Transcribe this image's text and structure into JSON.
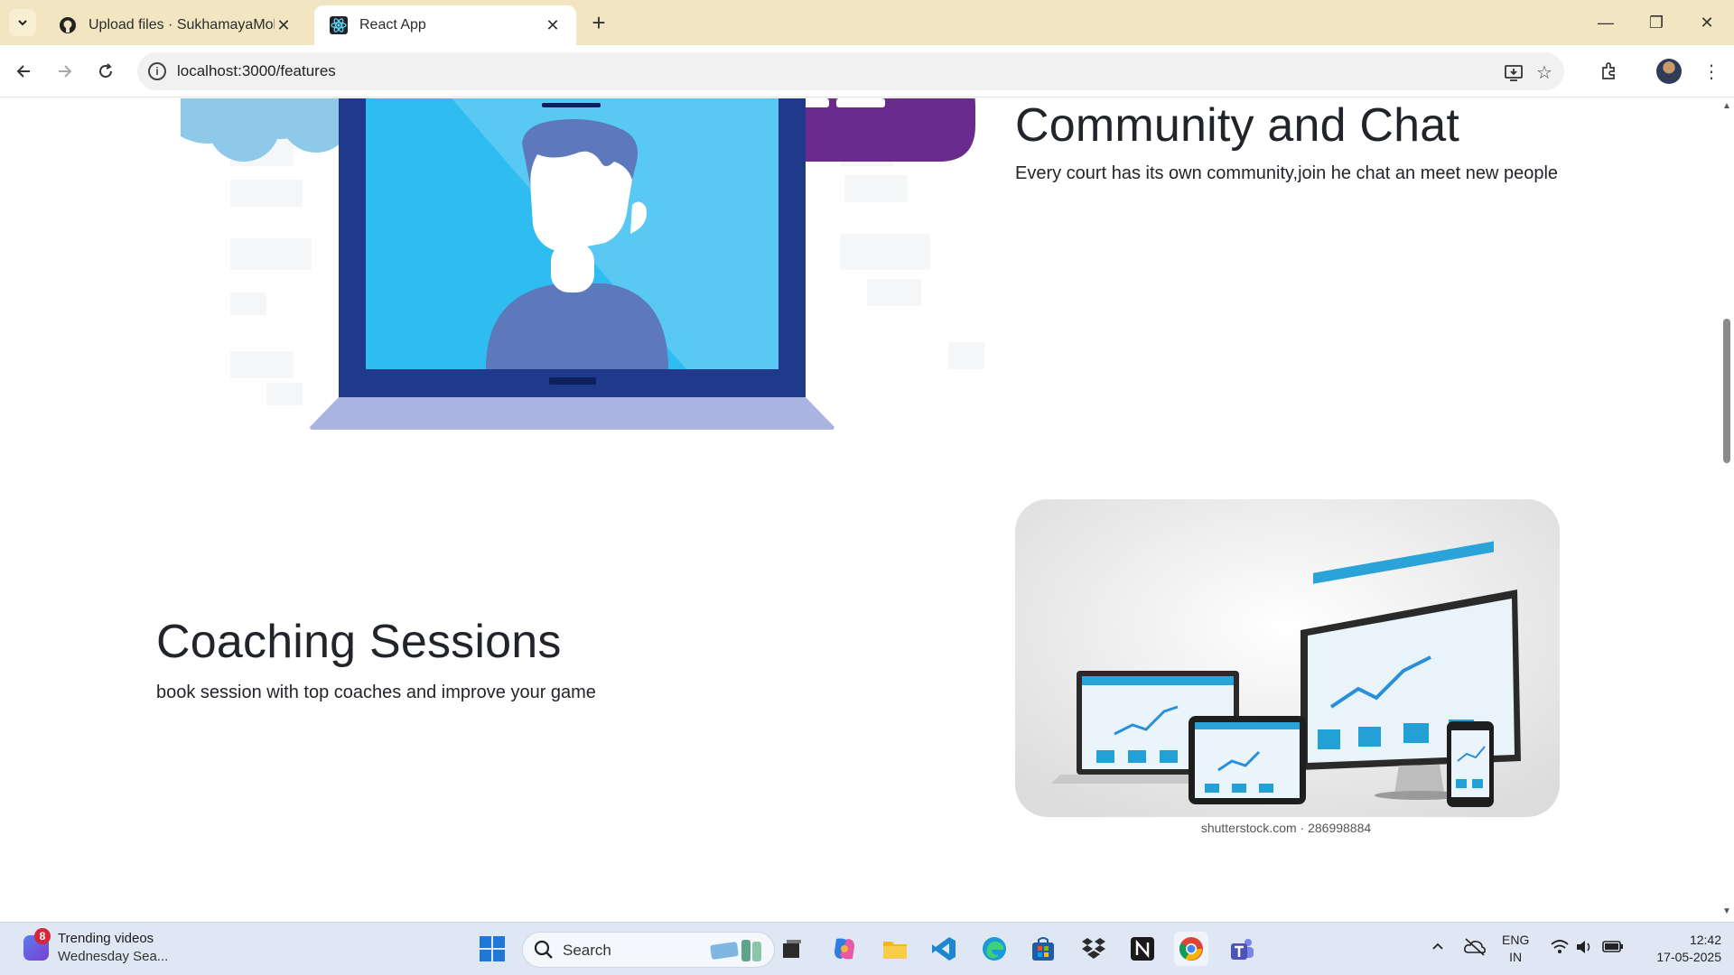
{
  "browser": {
    "tabs": [
      {
        "label": "Upload files · SukhamayaMohapatra",
        "icon": "github-icon"
      },
      {
        "label": "React App",
        "icon": "react-icon",
        "active": true
      }
    ],
    "address": "localhost:3000/features"
  },
  "page": {
    "community": {
      "title": "Community and Chat",
      "text": "Every court has its own community,join he chat an meet new people"
    },
    "coaching": {
      "title": "Coaching Sessions",
      "text": "book session with top coaches and improve your game"
    },
    "image_caption": "shutterstock.com · 286998884"
  },
  "taskbar": {
    "widget": {
      "badge": "8",
      "title": "Trending videos",
      "subtitle": "Wednesday Sea..."
    },
    "search_placeholder": "Search",
    "language": {
      "line1": "ENG",
      "line2": "IN"
    },
    "clock": {
      "time": "12:42",
      "date": "17-05-2025"
    }
  },
  "colors": {
    "tabbar": "#f2e6c2",
    "heading": "#212529",
    "laptop_screen": "#2fbcf0",
    "laptop_frame": "#1f3a8a",
    "chat_bubble": "#6a2c8c",
    "thought_cloud": "#8ec9ea"
  }
}
